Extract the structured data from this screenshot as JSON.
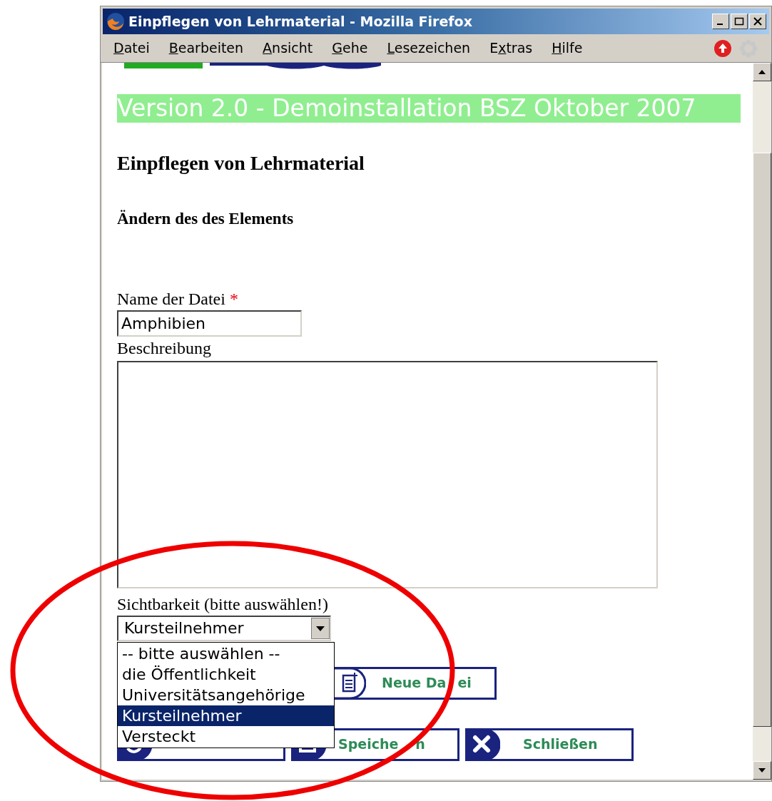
{
  "window": {
    "title": "Einpflegen von Lehrmaterial - Mozilla Firefox"
  },
  "menu": [
    {
      "key": "D",
      "after": "atei"
    },
    {
      "key": "B",
      "after": "earbeiten"
    },
    {
      "key": "A",
      "after": "nsicht"
    },
    {
      "key": "G",
      "after": "ehe"
    },
    {
      "key": "L",
      "after": "esezeichen"
    },
    {
      "before": "E",
      "key": "x",
      "after": "tras"
    },
    {
      "key": "H",
      "after": "ilfe"
    }
  ],
  "banner": "Version 2.0 - Demoinstallation BSZ Oktober 2007",
  "heading": "Einpflegen von Lehrmaterial",
  "subheading": "Ändern des des Elements",
  "fields": [
    {
      "kind": "input",
      "label": "Name der Datei",
      "required_mark": "*",
      "value": "Amphibien"
    },
    {
      "kind": "textarea",
      "label": "Beschreibung"
    }
  ],
  "visibility": {
    "label": "Sichtbarkeit (bitte auswählen!)",
    "value": "Kursteilnehmer",
    "expanded": true,
    "options": [
      {
        "label": "-- bitte auswählen --",
        "selected": false
      },
      {
        "label": "die Öffentlichkeit",
        "selected": false
      },
      {
        "label": "Universitätsangehörige",
        "selected": false
      },
      {
        "label": "Kursteilnehmer",
        "selected": true
      },
      {
        "label": "Versteckt",
        "selected": false
      }
    ]
  },
  "buttons": [
    {
      "kind": "new",
      "label": "Neue Da",
      "label_after": "ei"
    },
    {
      "kind": "reset"
    },
    {
      "kind": "save",
      "label": "Speiche",
      "label_after": "n"
    },
    {
      "kind": "close",
      "label": "Schließen"
    }
  ]
}
